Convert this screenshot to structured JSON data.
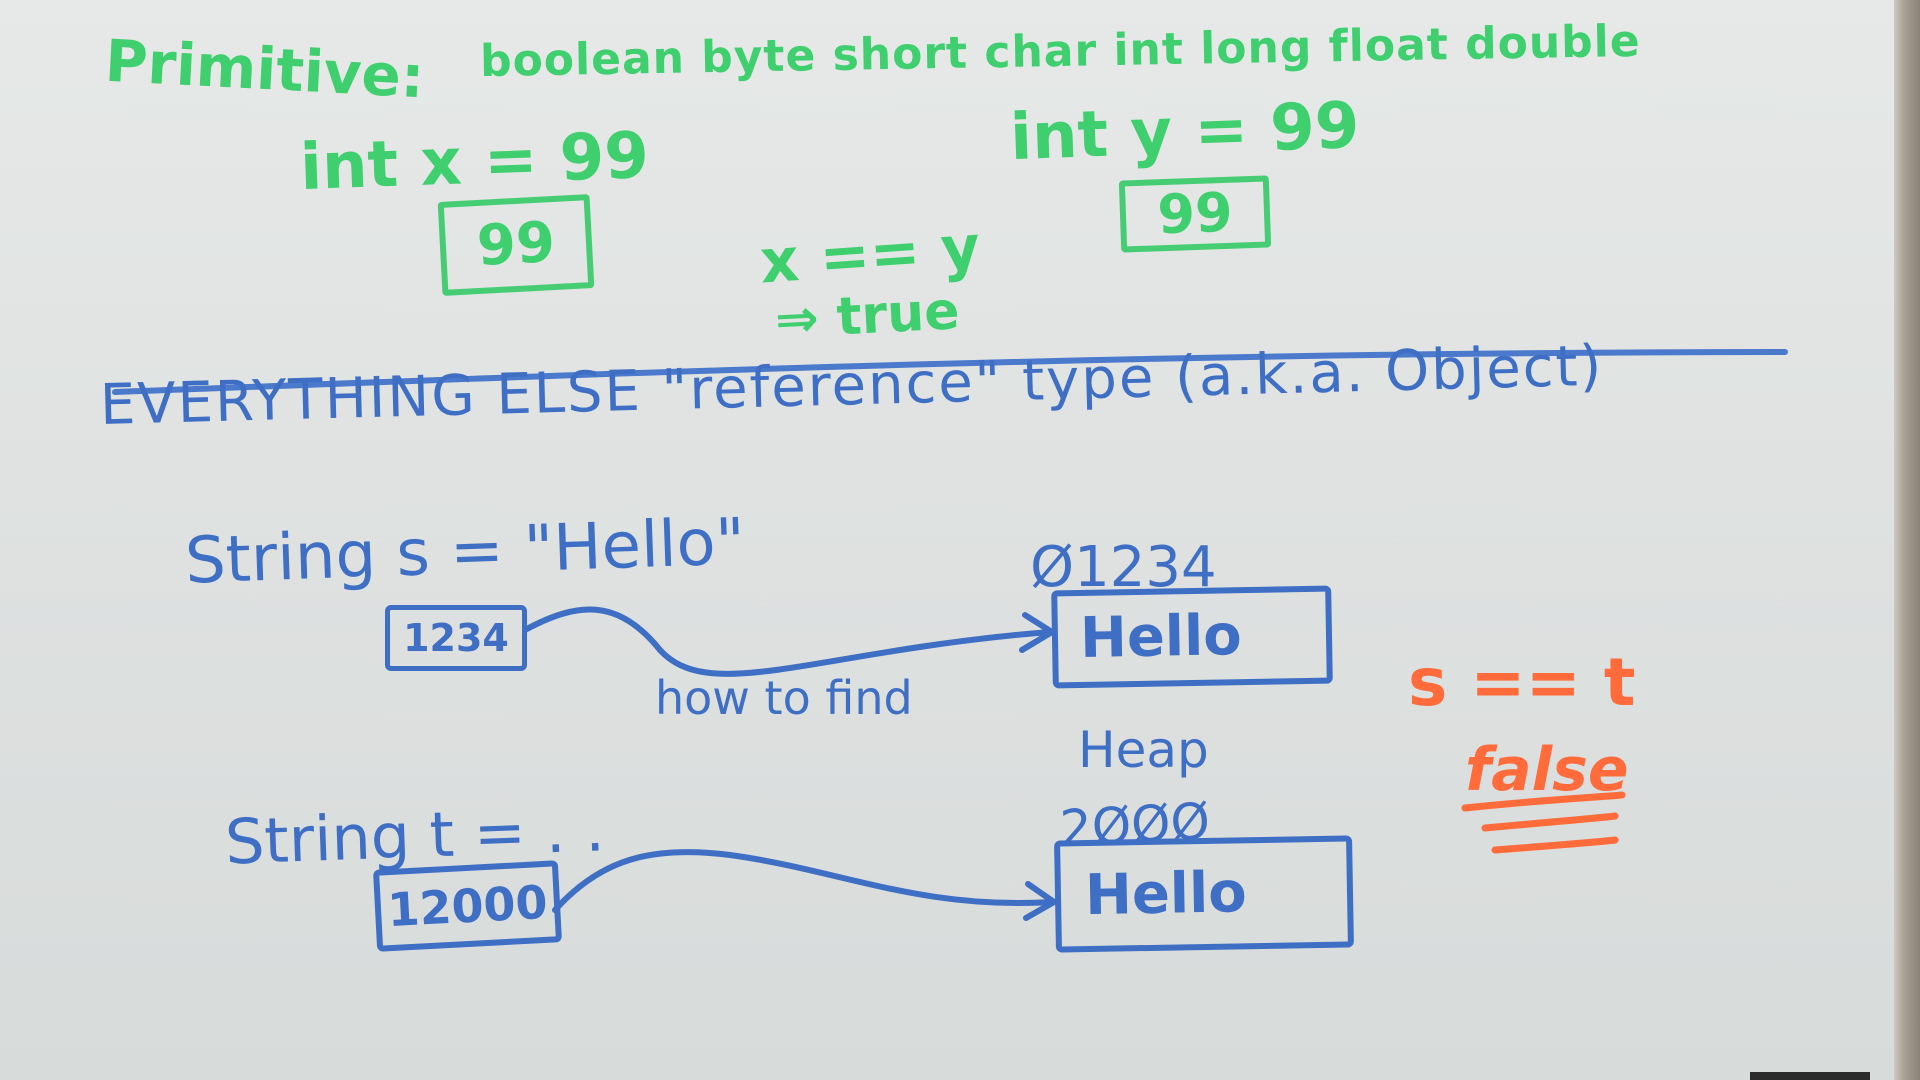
{
  "primitive": {
    "heading": "Primitive:",
    "types": "boolean byte short char int long float double",
    "x_decl": "int x = 99",
    "x_box": "99",
    "y_decl": "int y = 99",
    "y_box": "99",
    "compare": "x == y",
    "result": "⇒ true"
  },
  "reference": {
    "heading": "EVERYTHING ELSE \"reference\" type (a.k.a. Object)",
    "s_decl": "String s = \"Hello\"",
    "s_box": "1234",
    "arrow_label": "how to find",
    "s_address": "Ø1234",
    "s_object": "Hello",
    "heap_label": "Heap",
    "t_decl": "String t = . .",
    "t_box": "12000",
    "t_address": "2ØØØ",
    "t_object": "Hello"
  },
  "conclusion": {
    "compare": "s == t",
    "result": "false"
  },
  "colors": {
    "green_marker": "#3fcf6e",
    "blue_marker": "#3e6fc4",
    "orange_marker": "#ff6b3a",
    "board": "#e1e4e3"
  }
}
